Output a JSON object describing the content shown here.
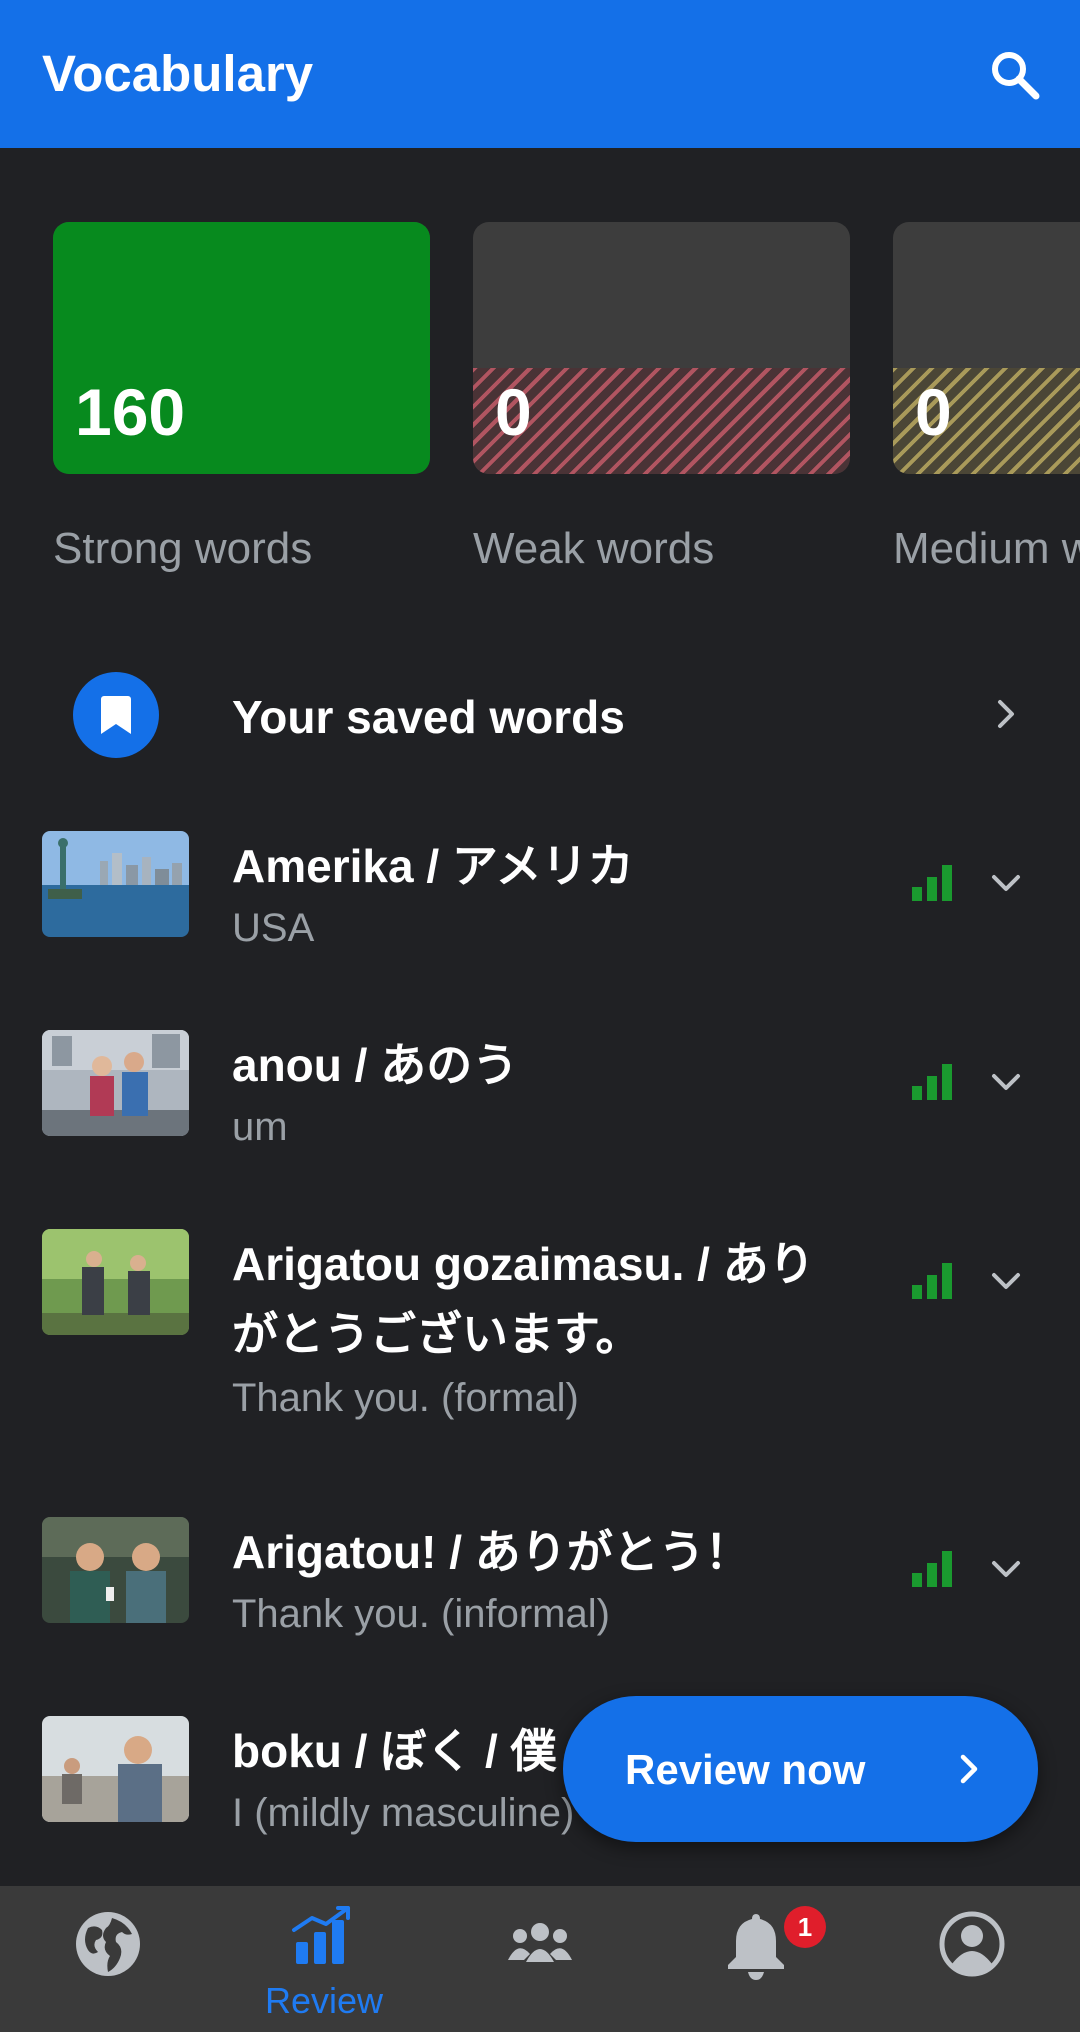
{
  "app_bar": {
    "title": "Vocabulary",
    "search_icon": "search-icon"
  },
  "stats": [
    {
      "count": "160",
      "label": "Strong words",
      "fill_fraction": 1.0,
      "color": "#078a1e"
    },
    {
      "count": "0",
      "label": "Weak words",
      "fill_fraction": 0.42,
      "color": "#b15561"
    },
    {
      "count": "0",
      "label": "Medium words",
      "fill_fraction": 0.42,
      "color": "#a99a5a"
    }
  ],
  "saved_words": {
    "label": "Your saved words",
    "icon": "bookmark-icon"
  },
  "words": [
    {
      "term": "Amerika / アメリカ",
      "meaning": "USA",
      "strength": "strong"
    },
    {
      "term": "anou / あのう",
      "meaning": "um",
      "strength": "strong"
    },
    {
      "term": "Arigatou gozaimasu. / ありがとうございます。",
      "meaning": "Thank you. (formal)",
      "strength": "strong"
    },
    {
      "term": "Arigatou! / ありがとう！",
      "meaning": "Thank you. (informal)",
      "strength": "strong"
    },
    {
      "term": "boku / ぼく / 僕",
      "meaning": "I (mildly masculine)",
      "strength": "strong"
    }
  ],
  "review_button": {
    "label": "Review now"
  },
  "bottom_nav": [
    {
      "icon": "globe-icon",
      "label": ""
    },
    {
      "icon": "review-chart-icon",
      "label": "Review",
      "active": true
    },
    {
      "icon": "community-icon",
      "label": ""
    },
    {
      "icon": "bell-icon",
      "label": "",
      "badge": "1"
    },
    {
      "icon": "profile-icon",
      "label": ""
    }
  ],
  "colors": {
    "accent": "#1470e8",
    "strong": "#078a1e",
    "background": "#202124",
    "badge": "#e01e2b"
  }
}
